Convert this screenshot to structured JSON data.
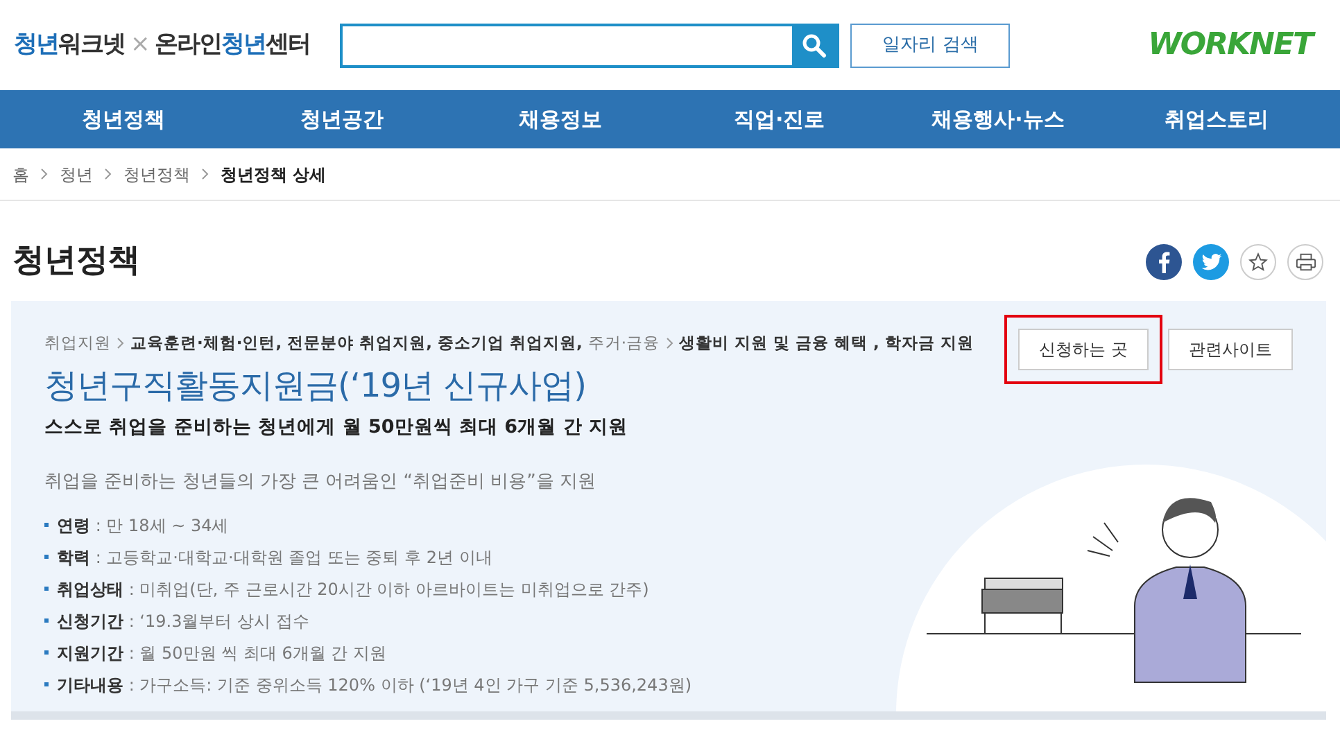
{
  "header": {
    "site_logo": {
      "left": [
        {
          "text": "청년",
          "kind": "accent"
        },
        {
          "text": "워크넷",
          "kind": "plain"
        }
      ],
      "separator": "×",
      "right": [
        {
          "text": "온라인",
          "kind": "plain"
        },
        {
          "text": "청년",
          "kind": "accent"
        },
        {
          "text": "센터",
          "kind": "plain"
        }
      ]
    },
    "job_search_button": "일자리 검색",
    "brand_logo": "WORKNET"
  },
  "nav": [
    {
      "label": "청년정책"
    },
    {
      "label": "청년공간"
    },
    {
      "label": "채용정보"
    },
    {
      "label": "직업·진로"
    },
    {
      "label": "채용행사·뉴스"
    },
    {
      "label": "취업스토리"
    }
  ],
  "breadcrumb": [
    {
      "label": "홈",
      "current": false
    },
    {
      "label": "청년",
      "current": false
    },
    {
      "label": "청년정책",
      "current": false
    },
    {
      "label": "청년정책 상세",
      "current": true
    }
  ],
  "page_title": "청년정책",
  "policy": {
    "categories": [
      {
        "parent": "취업지원",
        "items": "교육훈련·체험·인턴, 전문분야 취업지원, 중소기업 취업지원,"
      },
      {
        "parent": "주거·금융",
        "items": "생활비 지원 및 금융 혜택 , 학자금 지원"
      }
    ],
    "title": "청년구직활동지원금(‘19년 신규사업)",
    "subtitle": "스스로 취업을 준비하는 청년에게 월 50만원씩 최대 6개월 간 지원",
    "summary": "취업을 준비하는 청년들의 가장 큰 어려움인 “취업준비 비용”을 지원",
    "details": [
      {
        "label": "연령",
        "value": " : 만 18세 ~ 34세"
      },
      {
        "label": "학력",
        "value": " : 고등학교·대학교·대학원 졸업 또는 중퇴 후 2년 이내"
      },
      {
        "label": "취업상태",
        "value": " : 미취업(단, 주 근로시간 20시간 이하 아르바이트는 미취업으로 간주)"
      },
      {
        "label": "신청기간",
        "value": " : ‘19.3월부터 상시 접수"
      },
      {
        "label": "지원기간",
        "value": " : 월 50만원 씩 최대 6개월 간 지원"
      },
      {
        "label": "기타내용",
        "value": " : 가구소득: 기준 중위소득 120% 이하 (‘19년 4인 가구 기준 5,536,243원)"
      }
    ],
    "buttons": [
      {
        "label": "신청하는 곳",
        "highlighted": true
      },
      {
        "label": "관련사이트",
        "highlighted": false
      }
    ]
  }
}
